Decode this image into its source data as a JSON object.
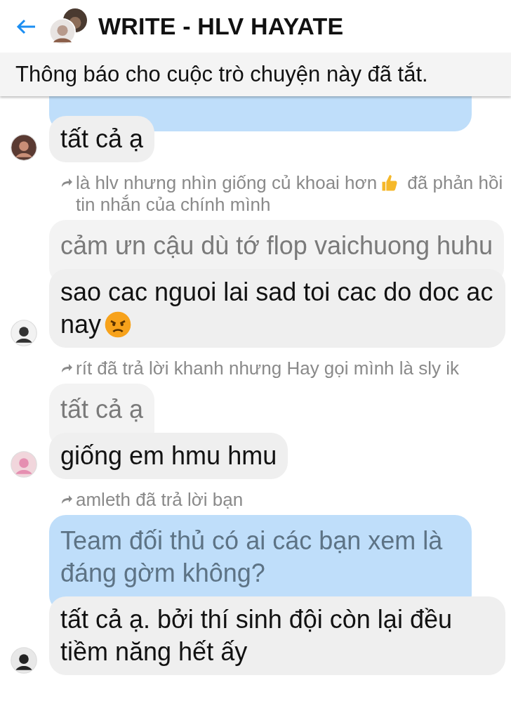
{
  "header": {
    "title": "WRITE - HLV HAYATE"
  },
  "notice": "Thông báo cho cuộc trò chuyện này đã tắt.",
  "thread": [
    {
      "kind": "message",
      "quote": {
        "mine": true
      },
      "text": "tất cả ạ"
    },
    {
      "kind": "emoji-note",
      "before": "là hlv nhưng nhìn giống củ khoai hơn",
      "after": "đã phản hồi tin nhắn của chính mình"
    },
    {
      "kind": "emoji-message",
      "quote": {
        "mine": false,
        "text": "cảm ưn cậu dù tớ flop vaichuong huhu"
      },
      "text": "sao cac nguoi lai sad toi cac do doc ac nay"
    },
    {
      "kind": "note",
      "before": "rít đã trả lời khanh nhưng Hay gọi mình là sly ik"
    },
    {
      "kind": "message",
      "quote": {
        "mine": false,
        "text": "tất cả ạ"
      },
      "text": "giống em hmu hmu"
    },
    {
      "kind": "note",
      "before": "amleth đã trả lời bạn"
    },
    {
      "kind": "message",
      "quote": {
        "mine": true,
        "text": "Team đối thủ có ai các bạn xem là đáng gờm không?"
      },
      "text": "tất cả ạ. bởi thí sinh đội còn lại đều tiềm năng hết ấy"
    }
  ]
}
